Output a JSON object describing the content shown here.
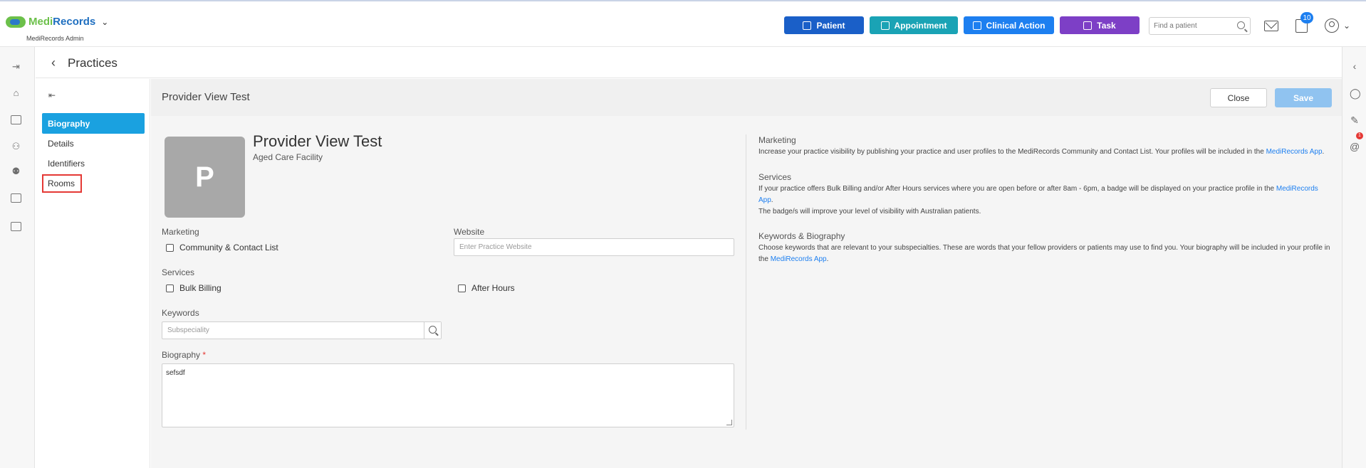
{
  "app": {
    "brand_part1": "Medi",
    "brand_part2": "Records",
    "subtitle": "MediRecords Admin"
  },
  "topbar": {
    "buttons": {
      "patient": "Patient",
      "appointment": "Appointment",
      "clinical_action": "Clinical Action",
      "task": "Task"
    },
    "search_placeholder": "Find a patient",
    "task_badge": "10",
    "colors": {
      "patient": "#1a5fc8",
      "appointment": "#1aa3b5",
      "clinical_action": "#1d7ff0",
      "task": "#7d3fc6"
    }
  },
  "right_rail": {
    "notification_badge": "1"
  },
  "page": {
    "title": "Practices"
  },
  "left_nav": {
    "items": [
      {
        "label": "Biography",
        "active": true
      },
      {
        "label": "Details"
      },
      {
        "label": "Identifiers"
      },
      {
        "label": "Rooms",
        "highlighted": true
      }
    ]
  },
  "form": {
    "header_title": "Provider View Test",
    "close_label": "Close",
    "save_label": "Save",
    "avatar_initial": "P",
    "provider_name": "Provider View Test",
    "provider_type": "Aged Care Facility",
    "marketing_label": "Marketing",
    "community_label": "Community & Contact List",
    "website_label": "Website",
    "website_placeholder": "Enter Practice Website",
    "services_label": "Services",
    "bulk_billing_label": "Bulk Billing",
    "after_hours_label": "After Hours",
    "keywords_label": "Keywords",
    "keywords_placeholder": "Subspeciality",
    "biography_label": "Biography",
    "biography_required": "*",
    "biography_value": "sefsdf"
  },
  "help": {
    "marketing_title": "Marketing",
    "marketing_text": "Increase your practice visibility by publishing your practice and user profiles to the MediRecords Community and Contact List. Your profiles will be included in the",
    "marketing_link": "MediRecords App",
    "services_title": "Services",
    "services_text1": "If your practice offers Bulk Billing and/or After Hours services where you are open before or after 8am - 6pm, a badge will be displayed on your practice profile in the",
    "services_link": "MediRecords App",
    "services_text2": "The badge/s will improve your level of visibility with Australian patients.",
    "keywords_title": "Keywords & Biography",
    "keywords_text": "Choose keywords that are relevant to your subspecialties. These are words that your fellow providers or patients may use to find you. Your biography will be included in your profile in the",
    "keywords_link": "MediRecords App"
  }
}
